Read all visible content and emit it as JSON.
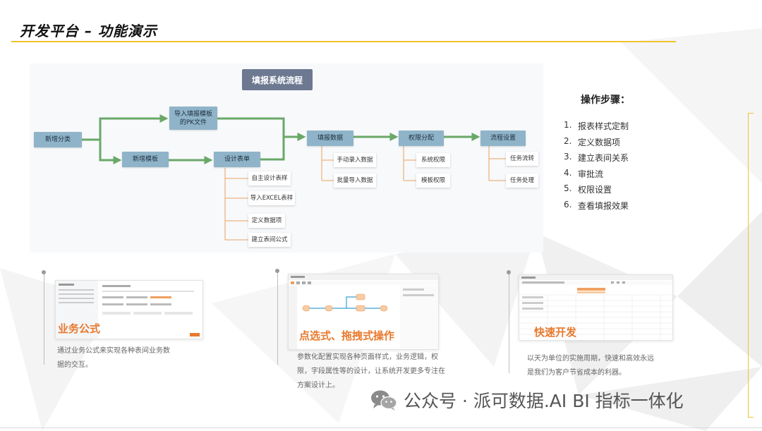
{
  "page": {
    "title": "开发平台 – 功能演示"
  },
  "flow": {
    "title": "填报系统流程",
    "nodes": {
      "add_category": "新增分类",
      "import_template": "导入填报模板的PK文件",
      "add_template": "新增模板",
      "design_form": "设计表单",
      "fill_data": "填报数据",
      "permission": "权限分配",
      "process_setup": "流程设置"
    },
    "design_form_subs": [
      "自主设计表样",
      "导入EXCEL表样",
      "定义数据项",
      "建立表间公式"
    ],
    "fill_data_subs": [
      "手动录入数据",
      "批量导入数据"
    ],
    "permission_subs": [
      "系统权限",
      "模板权限"
    ],
    "process_subs": [
      "任务流转",
      "任务处理"
    ]
  },
  "steps": {
    "title": "操作步骤：",
    "items": [
      {
        "num": "1.",
        "label": "报表样式定制"
      },
      {
        "num": "2.",
        "label": "定义数据项"
      },
      {
        "num": "3.",
        "label": "建立表间关系"
      },
      {
        "num": "4.",
        "label": "审批流"
      },
      {
        "num": "5.",
        "label": "权限设置"
      },
      {
        "num": "6.",
        "label": "查看填报效果"
      }
    ]
  },
  "features": [
    {
      "heading": "业务公式",
      "desc": "通过业务公式来实现各种表间业务数据的交互。"
    },
    {
      "heading": "点选式、拖拽式操作",
      "desc": "参数化配置实现各种页面样式，业务逻辑，权限，字段属性等的设计，让系统开发更多专注在方案设计上。"
    },
    {
      "heading": "快速开发",
      "desc": "以天为单位的实施周期，快速和高效永远是我们为客户节省成本的利器。"
    }
  ],
  "watermark": {
    "text": "公众号 · 派可数据.AI BI 指标一体化",
    "icon": "wechat-icon"
  },
  "colors": {
    "accent_yellow": "#f1c232",
    "node_blue": "#8fb4c9",
    "title_slate": "#6d7891",
    "arrow_green": "#6aa868",
    "sub_orange": "#e8a25f",
    "feature_orange": "#e8792d"
  }
}
